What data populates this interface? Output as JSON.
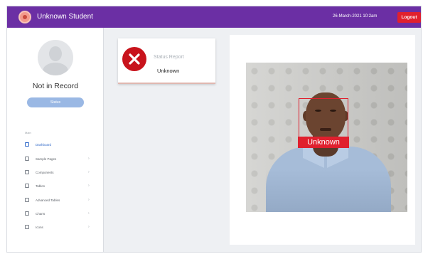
{
  "header": {
    "app_title": "Unknown Student",
    "datetime": "26-March-2021 10:2am",
    "logout_label": "Logout"
  },
  "sidebar": {
    "record_status": "Not in Record",
    "profile_button_label": "Status",
    "nav_heading": "Main",
    "items": [
      {
        "label": "Dashboard",
        "icon": "dashboard-icon"
      },
      {
        "label": "Sample Pages",
        "icon": "pages-icon"
      },
      {
        "label": "Components",
        "icon": "components-icon"
      },
      {
        "label": "Tables",
        "icon": "table-icon"
      },
      {
        "label": "Advanced Tables",
        "icon": "advanced-table-icon"
      },
      {
        "label": "Charts",
        "icon": "chart-icon"
      },
      {
        "label": "Icons",
        "icon": "icons-icon"
      }
    ]
  },
  "status_card": {
    "title": "Status Report",
    "value": "Unknown",
    "icon": "error-x-icon"
  },
  "camera": {
    "detection_label": "Unknown"
  },
  "colors": {
    "topbar": "#6b2fa4",
    "logout": "#e0202e",
    "detection_box": "#e0202e",
    "status_icon": "#c8131c",
    "accent_button": "#9ab8e4"
  }
}
